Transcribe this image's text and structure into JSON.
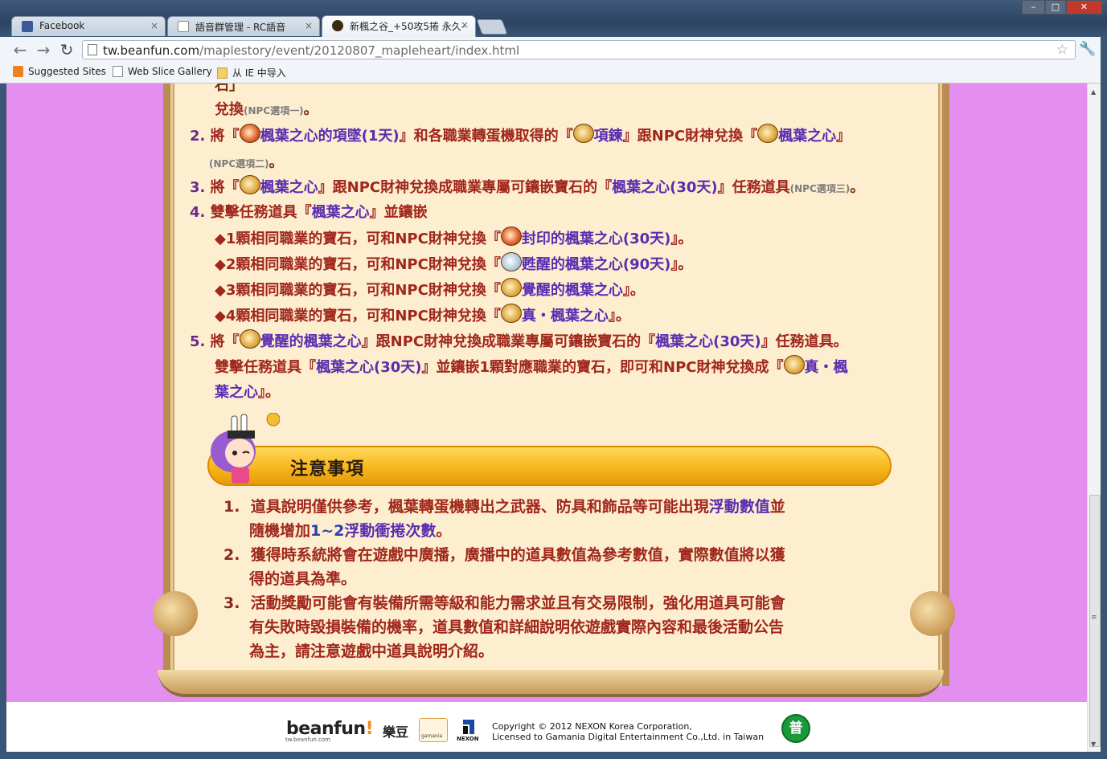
{
  "tabs": [
    {
      "label": "Facebook",
      "close": "×"
    },
    {
      "label": "語音群管理 - RC語音",
      "close": "×"
    },
    {
      "label": "新楓之谷_+50攻5捲 永久-",
      "close": "×"
    }
  ],
  "window_controls": {
    "minimize": "–",
    "maximize": "□",
    "close": "✕"
  },
  "address_bar": {
    "host": "tw.beanfun.com",
    "path": "/maplestory/event/20120807_mapleheart/index.html"
  },
  "bookmarks": [
    {
      "label": "Suggested Sites"
    },
    {
      "label": "Web Slice Gallery"
    },
    {
      "label": "从 IE 中导入"
    }
  ],
  "content": {
    "line0a": "石」",
    "line0b": "兌換",
    "line0b_note": "(NPC選項一)",
    "line0b_end": "。",
    "item2": {
      "num": "2.",
      "t1": "將『",
      "t2": "楓葉之心的項墜(1天)",
      "t3": "』和各職業轉蛋機取得的『",
      "t4": "項鍊",
      "t5": "』跟NPC財神兌換『",
      "t6": "楓葉之心",
      "t7": "』",
      "note": "(NPC選項二)",
      "end": "。"
    },
    "item3": {
      "num": "3.",
      "t1": "將『",
      "t2": "楓葉之心",
      "t3": "』跟NPC財神兌換成職業專屬可鑲嵌寶石的『",
      "t4": "楓葉之心(30天)",
      "t5": "』任務道具",
      "note": "(NPC選項三)",
      "end": "。"
    },
    "item4": {
      "num": "4.",
      "t1": "雙擊任務道具『",
      "t2": "楓葉之心",
      "t3": "』並鑲嵌"
    },
    "sub": [
      {
        "t1": "◆1顆相同職業的寶石，可和NPC財神兌換『",
        "t2": "封印的楓葉之心(30天)",
        "t3": "』。"
      },
      {
        "t1": "◆2顆相同職業的寶石，可和NPC財神兌換『",
        "t2": "甦醒的楓葉之心(90天)",
        "t3": "』。"
      },
      {
        "t1": "◆3顆相同職業的寶石，可和NPC財神兌換『",
        "t2": "覺醒的楓葉之心",
        "t3": "』。"
      },
      {
        "t1": "◆4顆相同職業的寶石，可和NPC財神兌換『",
        "t2": "真・楓葉之心",
        "t3": "』。"
      }
    ],
    "item5": {
      "num": "5.",
      "t1": "將『",
      "t2": "覺醒的楓葉之心",
      "t3": "』跟NPC財神兌換成職業專屬可鑲嵌寶石的『",
      "t4": "楓葉之心(30天)",
      "t5": "』任務道具。",
      "l2a": "雙擊任務道具『",
      "l2b": "楓葉之心(30天)",
      "l2c": "』並鑲嵌1顆對應職業的寶石，即可和NPC財神兌換成『",
      "l2d": "真・楓",
      "l3a": "葉之心",
      "l3b": "』。"
    }
  },
  "notice": {
    "title": "注意事項",
    "items": [
      {
        "num": "1.",
        "a": "道具說明僅供參考，楓葉轉蛋機轉出之武器、防具和飾品等可能出現",
        "b": "浮動數值",
        "c": "並",
        "d": "隨機增加",
        "e": "1~2",
        "f": "浮動衝捲次數",
        "g": "。"
      },
      {
        "num": "2.",
        "l1": "獲得時系統將會在遊戲中廣播，廣播中的道具數值為參考數值，實際數值將以獲",
        "l2": "得的道具為準。"
      },
      {
        "num": "3.",
        "l1": "活動獎勵可能會有裝備所需等級和能力需求並且有交易限制，強化用道具可能會",
        "l2": "有失敗時毀損裝備的機率，道具數值和詳細說明依遊戲實際內容和最後活動公告",
        "l3": "為主，請注意遊戲中道具說明介紹。"
      }
    ]
  },
  "footer": {
    "beanfun": "beanfun",
    "beanfun_excl": "!",
    "beanfun_cn": "樂豆",
    "beanfun_sub": "tw.beanfun.com",
    "gamania": "gamania",
    "nexon": "NEXON",
    "copyright_line1": "Copyright © 2012 NEXON Korea Corporation,",
    "copyright_line2": "Licensed to Gamania Digital Entertainment Co.,Ltd. in Taiwan",
    "rating": "普"
  },
  "colors": {
    "page_bg": "#e48ef0",
    "scroll_bg": "#feeed0",
    "text_red": "#a0271c",
    "text_purple": "#5a2db0",
    "notice_bar": "#f6b418"
  }
}
